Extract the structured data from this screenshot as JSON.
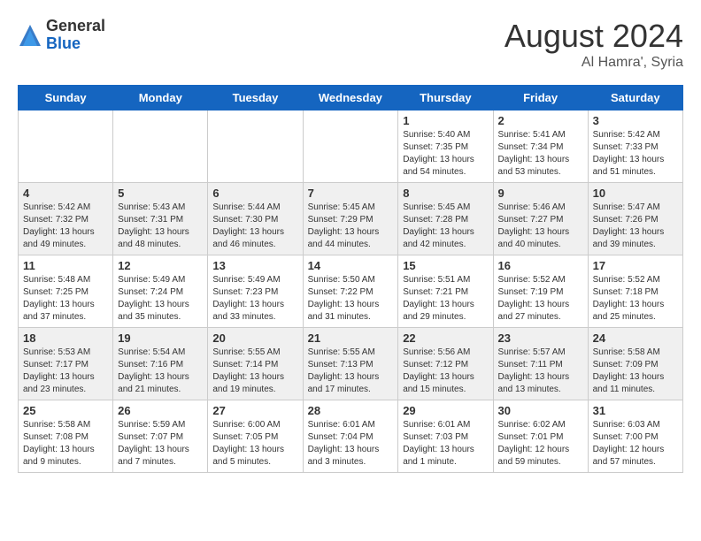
{
  "header": {
    "logo_general": "General",
    "logo_blue": "Blue",
    "month_year": "August 2024",
    "location": "Al Hamra', Syria"
  },
  "days_of_week": [
    "Sunday",
    "Monday",
    "Tuesday",
    "Wednesday",
    "Thursday",
    "Friday",
    "Saturday"
  ],
  "weeks": [
    [
      {
        "day": "",
        "info": ""
      },
      {
        "day": "",
        "info": ""
      },
      {
        "day": "",
        "info": ""
      },
      {
        "day": "",
        "info": ""
      },
      {
        "day": "1",
        "info": "Sunrise: 5:40 AM\nSunset: 7:35 PM\nDaylight: 13 hours\nand 54 minutes."
      },
      {
        "day": "2",
        "info": "Sunrise: 5:41 AM\nSunset: 7:34 PM\nDaylight: 13 hours\nand 53 minutes."
      },
      {
        "day": "3",
        "info": "Sunrise: 5:42 AM\nSunset: 7:33 PM\nDaylight: 13 hours\nand 51 minutes."
      }
    ],
    [
      {
        "day": "4",
        "info": "Sunrise: 5:42 AM\nSunset: 7:32 PM\nDaylight: 13 hours\nand 49 minutes."
      },
      {
        "day": "5",
        "info": "Sunrise: 5:43 AM\nSunset: 7:31 PM\nDaylight: 13 hours\nand 48 minutes."
      },
      {
        "day": "6",
        "info": "Sunrise: 5:44 AM\nSunset: 7:30 PM\nDaylight: 13 hours\nand 46 minutes."
      },
      {
        "day": "7",
        "info": "Sunrise: 5:45 AM\nSunset: 7:29 PM\nDaylight: 13 hours\nand 44 minutes."
      },
      {
        "day": "8",
        "info": "Sunrise: 5:45 AM\nSunset: 7:28 PM\nDaylight: 13 hours\nand 42 minutes."
      },
      {
        "day": "9",
        "info": "Sunrise: 5:46 AM\nSunset: 7:27 PM\nDaylight: 13 hours\nand 40 minutes."
      },
      {
        "day": "10",
        "info": "Sunrise: 5:47 AM\nSunset: 7:26 PM\nDaylight: 13 hours\nand 39 minutes."
      }
    ],
    [
      {
        "day": "11",
        "info": "Sunrise: 5:48 AM\nSunset: 7:25 PM\nDaylight: 13 hours\nand 37 minutes."
      },
      {
        "day": "12",
        "info": "Sunrise: 5:49 AM\nSunset: 7:24 PM\nDaylight: 13 hours\nand 35 minutes."
      },
      {
        "day": "13",
        "info": "Sunrise: 5:49 AM\nSunset: 7:23 PM\nDaylight: 13 hours\nand 33 minutes."
      },
      {
        "day": "14",
        "info": "Sunrise: 5:50 AM\nSunset: 7:22 PM\nDaylight: 13 hours\nand 31 minutes."
      },
      {
        "day": "15",
        "info": "Sunrise: 5:51 AM\nSunset: 7:21 PM\nDaylight: 13 hours\nand 29 minutes."
      },
      {
        "day": "16",
        "info": "Sunrise: 5:52 AM\nSunset: 7:19 PM\nDaylight: 13 hours\nand 27 minutes."
      },
      {
        "day": "17",
        "info": "Sunrise: 5:52 AM\nSunset: 7:18 PM\nDaylight: 13 hours\nand 25 minutes."
      }
    ],
    [
      {
        "day": "18",
        "info": "Sunrise: 5:53 AM\nSunset: 7:17 PM\nDaylight: 13 hours\nand 23 minutes."
      },
      {
        "day": "19",
        "info": "Sunrise: 5:54 AM\nSunset: 7:16 PM\nDaylight: 13 hours\nand 21 minutes."
      },
      {
        "day": "20",
        "info": "Sunrise: 5:55 AM\nSunset: 7:14 PM\nDaylight: 13 hours\nand 19 minutes."
      },
      {
        "day": "21",
        "info": "Sunrise: 5:55 AM\nSunset: 7:13 PM\nDaylight: 13 hours\nand 17 minutes."
      },
      {
        "day": "22",
        "info": "Sunrise: 5:56 AM\nSunset: 7:12 PM\nDaylight: 13 hours\nand 15 minutes."
      },
      {
        "day": "23",
        "info": "Sunrise: 5:57 AM\nSunset: 7:11 PM\nDaylight: 13 hours\nand 13 minutes."
      },
      {
        "day": "24",
        "info": "Sunrise: 5:58 AM\nSunset: 7:09 PM\nDaylight: 13 hours\nand 11 minutes."
      }
    ],
    [
      {
        "day": "25",
        "info": "Sunrise: 5:58 AM\nSunset: 7:08 PM\nDaylight: 13 hours\nand 9 minutes."
      },
      {
        "day": "26",
        "info": "Sunrise: 5:59 AM\nSunset: 7:07 PM\nDaylight: 13 hours\nand 7 minutes."
      },
      {
        "day": "27",
        "info": "Sunrise: 6:00 AM\nSunset: 7:05 PM\nDaylight: 13 hours\nand 5 minutes."
      },
      {
        "day": "28",
        "info": "Sunrise: 6:01 AM\nSunset: 7:04 PM\nDaylight: 13 hours\nand 3 minutes."
      },
      {
        "day": "29",
        "info": "Sunrise: 6:01 AM\nSunset: 7:03 PM\nDaylight: 13 hours\nand 1 minute."
      },
      {
        "day": "30",
        "info": "Sunrise: 6:02 AM\nSunset: 7:01 PM\nDaylight: 12 hours\nand 59 minutes."
      },
      {
        "day": "31",
        "info": "Sunrise: 6:03 AM\nSunset: 7:00 PM\nDaylight: 12 hours\nand 57 minutes."
      }
    ]
  ]
}
